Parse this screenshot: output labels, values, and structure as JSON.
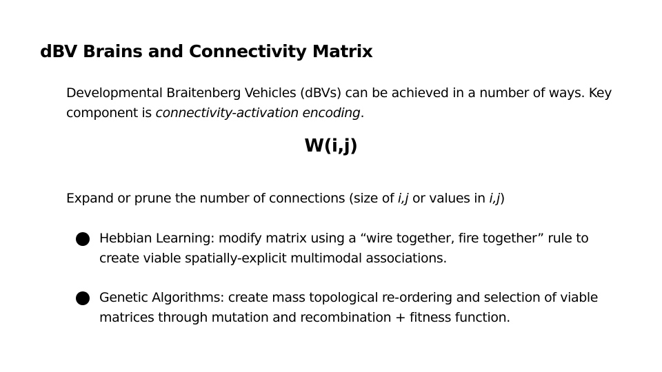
{
  "slide": {
    "title": "dBV Brains and Connectivity Matrix",
    "intro": {
      "text_before": "Developmental Braitenberg Vehicles (dBVs) can be achieved in a number of ways. Key component is ",
      "emphasis": "connectivity-activation encoding",
      "text_after": "."
    },
    "formula": "W(i,j)",
    "expand": {
      "text_1": "Expand or prune the number of connections (size of ",
      "emphasis_1": "i,j",
      "text_2": " or values in ",
      "emphasis_2": "i,j",
      "text_3": ")"
    },
    "bullets": [
      {
        "text": "Hebbian Learning: modify matrix using a “wire together, fire together” rule to create viable spatially-explicit multimodal associations."
      },
      {
        "text": "Genetic Algorithms: create mass topological re-ordering and selection of viable matrices through mutation and recombination + fitness function."
      }
    ]
  }
}
